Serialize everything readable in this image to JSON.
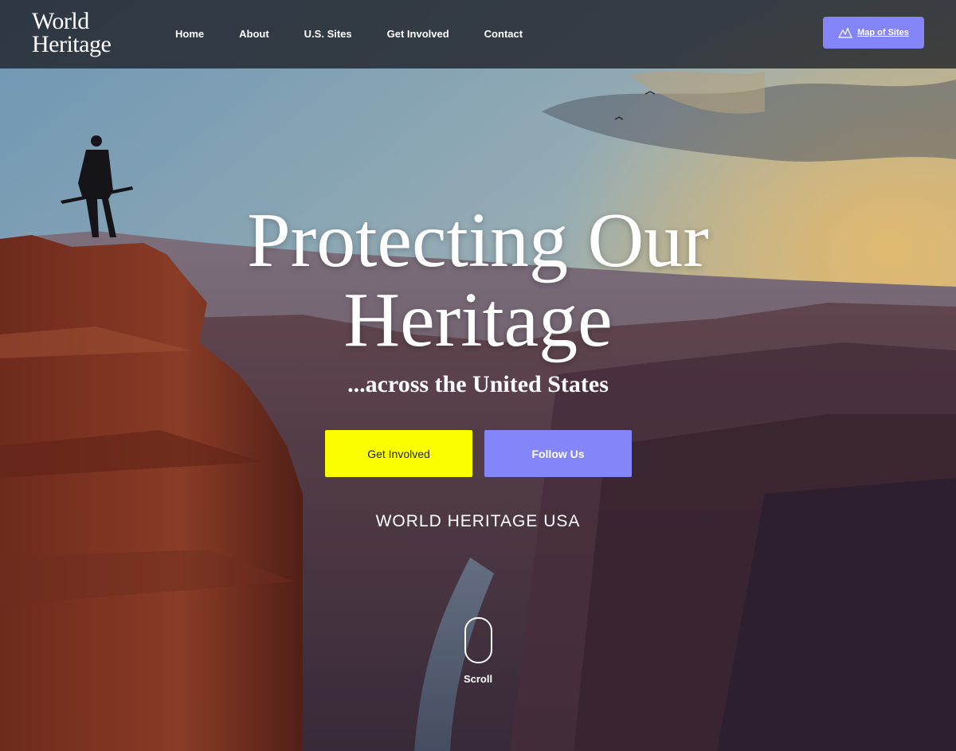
{
  "logo": {
    "line1": "World",
    "line2": "Heritage"
  },
  "nav": {
    "links": [
      "Home",
      "About",
      "U.S. Sites",
      "Get Involved",
      "Contact"
    ],
    "map_button": {
      "label": "Map of Sites",
      "icon": "mountain-map-icon"
    }
  },
  "hero": {
    "headline_line1": "Protecting Our",
    "headline_line2": "Heritage",
    "subheading": "...across the United States",
    "primary_button": "Get Involved",
    "secondary_button": "Follow Us",
    "brand_tag": "WORLD HERITAGE USA",
    "scroll_label": "Scroll"
  },
  "colors": {
    "accent_purple": "#8385f8",
    "accent_yellow": "#fbff00",
    "text_white": "#ffffff"
  }
}
